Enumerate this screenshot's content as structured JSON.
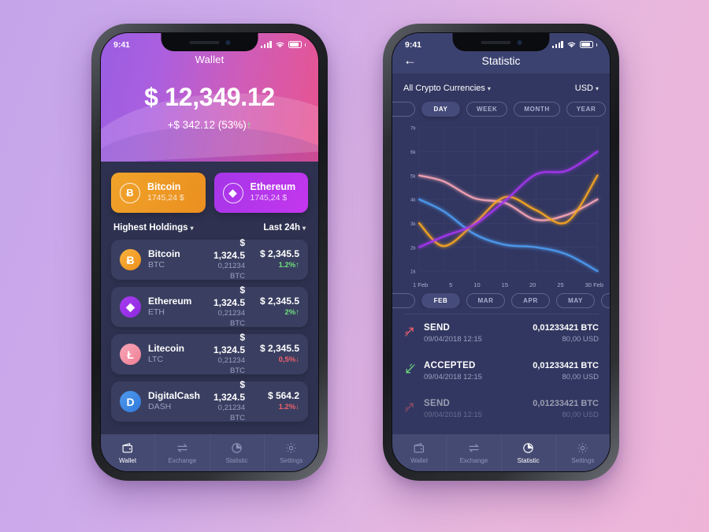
{
  "background": {
    "from": "#c6a4ea",
    "to": "#eeb4d8"
  },
  "phone1": {
    "status": {
      "time": "9:41"
    },
    "header": {
      "title": "Wallet",
      "balance": "$ 12,349.12",
      "delta": "+$ 342.12 (53%)",
      "delta_arrow": "↑",
      "gradient_from": "#9a5ee2",
      "gradient_to": "#e8548f"
    },
    "coin_cards": [
      {
        "name": "Bitcoin",
        "price": "1745,24 $",
        "glyph": "Ƀ",
        "color": "#eb8f20"
      },
      {
        "name": "Ethereum",
        "price": "1745,24 $",
        "glyph": "◆",
        "color": "#a536e8"
      }
    ],
    "filters": {
      "sort_label": "Highest Holdings",
      "period_label": "Last 24h",
      "caret": "▾"
    },
    "holdings": [
      {
        "name": "Bitcoin",
        "symbol": "BTC",
        "glyph": "Ƀ",
        "icon_class": "ic-btc",
        "price": "$ 1,324.5",
        "amount": "0,21234 BTC",
        "value": "$ 2,345.5",
        "change": "1.2%",
        "arrow": "↑",
        "direction": "up"
      },
      {
        "name": "Ethereum",
        "symbol": "ETH",
        "glyph": "◆",
        "icon_class": "ic-eth",
        "price": "$ 1,324.5",
        "amount": "0,21234 BTC",
        "value": "$ 2,345.5",
        "change": "2%",
        "arrow": "↑",
        "direction": "up"
      },
      {
        "name": "Litecoin",
        "symbol": "LTC",
        "glyph": "Ł",
        "icon_class": "ic-ltc",
        "price": "$ 1,324.5",
        "amount": "0,21234 BTC",
        "value": "$ 2,345.5",
        "change": "0,5%",
        "arrow": "↓",
        "direction": "down"
      },
      {
        "name": "DigitalCash",
        "symbol": "DASH",
        "glyph": "D",
        "icon_class": "ic-dash",
        "price": "$ 1,324.5",
        "amount": "0,21234 BTC",
        "value": "$ 564.2",
        "change": "1.2%",
        "arrow": "↓",
        "direction": "down"
      }
    ],
    "tabs": [
      {
        "label": "Wallet",
        "icon": "wallet-icon",
        "active": true
      },
      {
        "label": "Exchange",
        "icon": "exchange-icon",
        "active": false
      },
      {
        "label": "Statistic",
        "icon": "statistic-icon",
        "active": false
      },
      {
        "label": "Settings",
        "icon": "settings-icon",
        "active": false
      }
    ]
  },
  "phone2": {
    "status": {
      "time": "9:41"
    },
    "header": {
      "title": "Statistic",
      "back_icon": "←"
    },
    "filters": {
      "currency_label": "All Crypto Currencies",
      "fiat_label": "USD",
      "caret": "▾"
    },
    "periods": [
      {
        "label": "",
        "active": false,
        "cut": "left"
      },
      {
        "label": "DAY",
        "active": true
      },
      {
        "label": "WEEK",
        "active": false
      },
      {
        "label": "MONTH",
        "active": false
      },
      {
        "label": "YEAR",
        "active": false
      },
      {
        "label": "",
        "active": false,
        "cut": "right"
      }
    ],
    "months": [
      {
        "label": "",
        "active": false,
        "cut": "left"
      },
      {
        "label": "FEB",
        "active": true
      },
      {
        "label": "MAR",
        "active": false
      },
      {
        "label": "APR",
        "active": false
      },
      {
        "label": "MAY",
        "active": false
      },
      {
        "label": "",
        "active": false,
        "cut": "right"
      }
    ],
    "transactions": [
      {
        "type": "SEND",
        "date": "09/04/2018 12:15",
        "amount": "0,01233421 BTC",
        "usd": "80,00 USD",
        "icon": "send-arrow-icon",
        "color": "#f0606b",
        "faded": false
      },
      {
        "type": "ACCEPTED",
        "date": "09/04/2018 12:15",
        "amount": "0,01233421 BTC",
        "usd": "80,00 USD",
        "icon": "receive-arrow-icon",
        "color": "#6fe07c",
        "faded": false
      },
      {
        "type": "SEND",
        "date": "09/04/2018 12:15",
        "amount": "0,01233421 BTC",
        "usd": "80,00 USD",
        "icon": "send-arrow-icon",
        "color": "#f0606b",
        "faded": true
      }
    ],
    "tabs": [
      {
        "label": "Wallet",
        "icon": "wallet-icon",
        "active": false
      },
      {
        "label": "Exchange",
        "icon": "exchange-icon",
        "active": false
      },
      {
        "label": "Statistic",
        "icon": "statistic-icon",
        "active": true
      },
      {
        "label": "Settings",
        "icon": "settings-icon",
        "active": false
      }
    ]
  },
  "chart_data": {
    "type": "line",
    "title": "Statistic",
    "xlabel": "",
    "ylabel": "",
    "grid": true,
    "legend": "none",
    "xlim": [
      1,
      30
    ],
    "ylim": [
      1000,
      7000
    ],
    "x": [
      1,
      5,
      10,
      15,
      20,
      25,
      30
    ],
    "xtick_labels": [
      "1 Feb",
      "5",
      "10",
      "15",
      "20",
      "25",
      "30 Feb"
    ],
    "ytick_labels": [
      "7k",
      "6k",
      "5k",
      "4k",
      "3k",
      "2k",
      "1k"
    ],
    "ytick_values": [
      7000,
      6000,
      5000,
      4000,
      3000,
      2000,
      1000
    ],
    "series": [
      {
        "name": "pink",
        "color": "#f3a3b4",
        "values": [
          5000,
          4750,
          4050,
          3850,
          3150,
          3350,
          4000
        ]
      },
      {
        "name": "blue",
        "color": "#4d9bf0",
        "values": [
          4000,
          3500,
          2550,
          2100,
          2000,
          1700,
          1000
        ]
      },
      {
        "name": "orange",
        "color": "#f5a623",
        "values": [
          3000,
          2050,
          3000,
          4100,
          3550,
          3050,
          5000
        ]
      },
      {
        "name": "purple",
        "color": "#a435f0",
        "values": [
          2000,
          2450,
          2950,
          3950,
          5050,
          5200,
          6000
        ]
      }
    ]
  }
}
